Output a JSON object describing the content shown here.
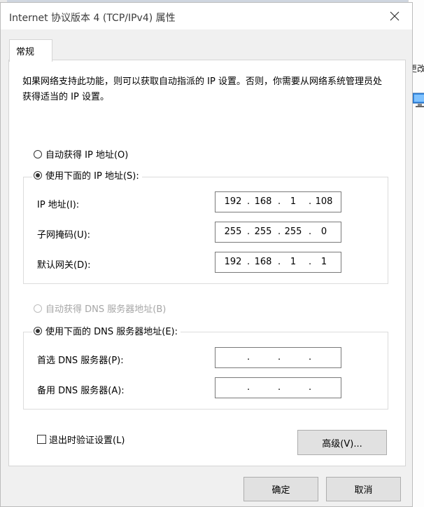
{
  "window": {
    "title": "Internet 协议版本 4 (TCP/IPv4) 属性"
  },
  "tab": {
    "label": "常规"
  },
  "description": "如果网络支持此功能，则可以获取自动指派的 IP 设置。否则，你需要从网络系统管理员处获得适当的 IP 设置。",
  "ip_section": {
    "auto_label": "自动获得 IP 地址(O)",
    "manual_label": "使用下面的 IP 地址(S):",
    "selected": "manual",
    "fields": [
      {
        "label": "IP 地址(I):",
        "octets": [
          "192",
          "168",
          "1",
          "108"
        ]
      },
      {
        "label": "子网掩码(U):",
        "octets": [
          "255",
          "255",
          "255",
          "0"
        ]
      },
      {
        "label": "默认网关(D):",
        "octets": [
          "192",
          "168",
          "1",
          "1"
        ]
      }
    ]
  },
  "dns_section": {
    "auto_label": "自动获得 DNS 服务器地址(B)",
    "auto_disabled": true,
    "manual_label": "使用下面的 DNS 服务器地址(E):",
    "selected": "manual",
    "fields": [
      {
        "label": "首选 DNS 服务器(P):",
        "octets": [
          "",
          "",
          "",
          ""
        ]
      },
      {
        "label": "备用 DNS 服务器(A):",
        "octets": [
          "",
          "",
          "",
          ""
        ]
      }
    ]
  },
  "validate_on_exit": {
    "label": "退出时验证设置(L)",
    "checked": false
  },
  "buttons": {
    "advanced": "高级(V)...",
    "ok": "确定",
    "cancel": "取消"
  },
  "background": {
    "partial_text": "更改"
  }
}
